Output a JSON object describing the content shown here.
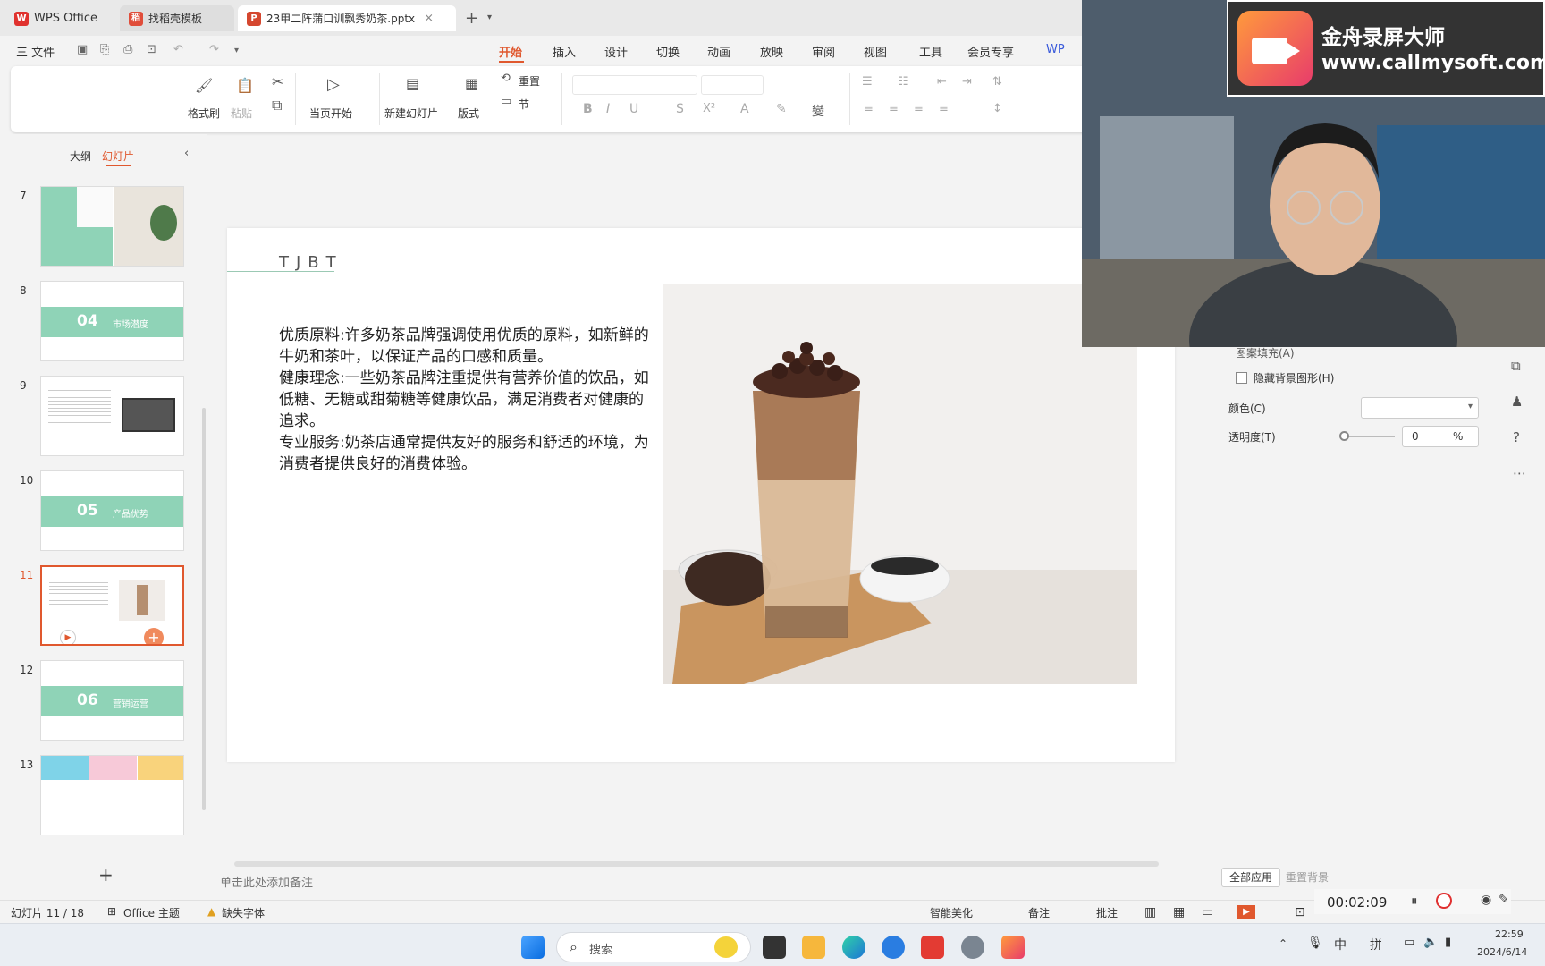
{
  "tabs": [
    {
      "label": "WPS Office"
    },
    {
      "label": "找稻壳模板"
    },
    {
      "label": "23甲二阵蒲口训飘秀奶茶.pptx"
    }
  ],
  "menu": {
    "file": "三 文件",
    "items": [
      "开始",
      "插入",
      "设计",
      "切换",
      "动画",
      "放映",
      "审阅",
      "视图",
      "工具",
      "会员专享",
      "WP"
    ]
  },
  "ribbon": {
    "format_painter": "格式刷",
    "paste": "粘贴",
    "from_current": "当页开始",
    "new_slide": "新建幻灯片",
    "layout": "版式",
    "reset": "重置",
    "section": "节"
  },
  "left": {
    "outline_tab": "大纲",
    "slides_tab": "幻灯片",
    "add": "+"
  },
  "slides": [
    {
      "num": "7"
    },
    {
      "num": "8",
      "band": "04",
      "sub": "市场潜度"
    },
    {
      "num": "9"
    },
    {
      "num": "10",
      "band": "05",
      "sub": "产品优势"
    },
    {
      "num": "11"
    },
    {
      "num": "12",
      "band": "06",
      "sub": "营销运营"
    },
    {
      "num": "13"
    }
  ],
  "slide": {
    "title": "TJBT",
    "body": "优质原料:许多奶茶品牌强调使用优质的原料，如新鲜的牛奶和茶叶，以保证产品的口感和质量。\n健康理念:一些奶茶品牌注重提供有营养价值的饮品，如低糖、无糖或甜菊糖等健康饮品，满足消费者对健康的追求。\n专业服务:奶茶店通常提供友好的服务和舒适的环境，为消费者提供良好的消费体验。"
  },
  "notes_placeholder": "单击此处添加备注",
  "panel": {
    "fill_option": "图案填充(A)",
    "hide_bg": "隐藏背景图形(H)",
    "color_label": "颜色(C)",
    "transparency_label": "透明度(T)",
    "transparency_value": "0",
    "percent": "%",
    "apply_all": "全部应用",
    "reset_bg": "重置背景"
  },
  "recorder": {
    "name": "金舟录屏大师",
    "url": "www.callmysoft.com",
    "timer": "00:02:09"
  },
  "status": {
    "slide_count": "幻灯片 11 / 18",
    "theme": "Office 主题",
    "missing_font": "缺失字体",
    "beautify": "智能美化",
    "notes": "备注",
    "comment": "批注"
  },
  "taskbar": {
    "search": "搜索",
    "ime1": "中",
    "ime2": "拼",
    "time": "22:59",
    "date": "2024/6/14"
  }
}
